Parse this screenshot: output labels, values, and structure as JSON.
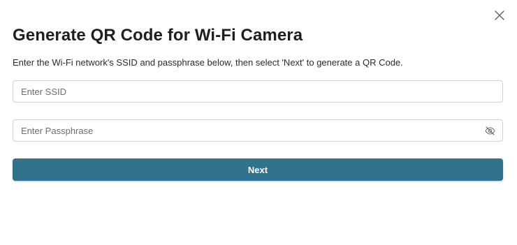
{
  "dialog": {
    "title": "Generate QR Code for Wi-Fi Camera",
    "description": "Enter the Wi-Fi network's SSID and passphrase below, then select 'Next' to generate a QR Code.",
    "close_icon": "close-icon"
  },
  "form": {
    "ssid": {
      "value": "",
      "placeholder": "Enter SSID"
    },
    "passphrase": {
      "value": "",
      "placeholder": "Enter Passphrase",
      "toggle_icon": "eye-slash-icon"
    }
  },
  "actions": {
    "next_label": "Next"
  },
  "colors": {
    "primary_button": "#31728c",
    "field_border": "#cfd3d7",
    "text": "#1f1f1f"
  }
}
